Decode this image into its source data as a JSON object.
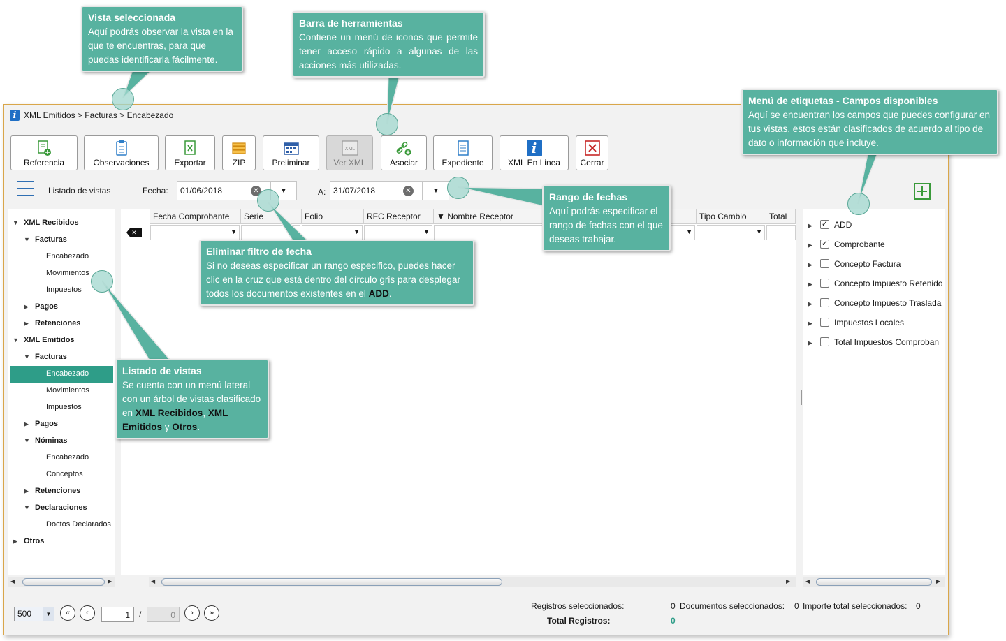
{
  "breadcrumb": "XML Emitidos > Facturas > Encabezado",
  "toolbar": {
    "referencia": "Referencia",
    "observaciones": "Observaciones",
    "exportar": "Exportar",
    "zip": "ZIP",
    "preliminar": "Preliminar",
    "ver_xml": "Ver XML",
    "asociar": "Asociar",
    "expediente": "Expediente",
    "xml_en_linea": "XML En Linea",
    "cerrar": "Cerrar",
    "xml_badge": "XML"
  },
  "filters": {
    "listado": "Listado de vistas",
    "fecha_label": "Fecha:",
    "fecha_desde": "01/06/2018",
    "a_label": "A:",
    "fecha_hasta": "31/07/2018"
  },
  "tree": {
    "xml_recibidos": "XML Recibidos",
    "facturas": "Facturas",
    "encabezado": "Encabezado",
    "movimientos": "Movimientos",
    "impuestos": "Impuestos",
    "pagos": "Pagos",
    "retenciones": "Retenciones",
    "xml_emitidos": "XML Emitidos",
    "nominas": "Nóminas",
    "conceptos": "Conceptos",
    "declaraciones": "Declaraciones",
    "doctos_declarados": "Doctos Declarados",
    "otros": "Otros"
  },
  "grid": {
    "columns": [
      "Fecha Comprobante",
      "Serie",
      "Folio",
      "RFC Receptor",
      "▼ Nombre Receptor",
      "Tipo Cambio",
      "Total"
    ]
  },
  "tags": {
    "items": [
      {
        "label": "ADD",
        "checked": true
      },
      {
        "label": "Comprobante",
        "checked": true
      },
      {
        "label": "Concepto Factura",
        "checked": false
      },
      {
        "label": "Concepto Impuesto Retenido",
        "checked": false
      },
      {
        "label": "Concepto Impuesto Traslada",
        "checked": false
      },
      {
        "label": "Impuestos Locales",
        "checked": false
      },
      {
        "label": "Total Impuestos Comproban",
        "checked": false
      }
    ],
    "check_mark": "✓"
  },
  "bottom": {
    "page_size": "500",
    "page": "1",
    "slash": "/",
    "total_pages": "0",
    "registros_sel_label": "Registros seleccionados:",
    "registros_sel_value": "0",
    "documentos_sel_label": "Documentos seleccionados:",
    "documentos_sel_value": "0",
    "importe_label": "Importe total seleccionados:",
    "importe_value": "0",
    "total_registros_label": "Total Registros:",
    "total_registros_value": "0"
  },
  "callouts": {
    "vista": {
      "title": "Vista seleccionada",
      "text": "Aquí podrás observar la vista en la que te encuentras, para que puedas identificarla fácilmente."
    },
    "barra": {
      "title": "Barra de herramientas",
      "text": "Contiene un menú de iconos que permite tener acceso rápido a algunas de las acciones más utilizadas."
    },
    "etiquetas": {
      "title": "Menú de etiquetas - Campos disponibles",
      "text": "Aquí se encuentran los campos que puedes configurar en tus vistas, estos están clasificados de acuerdo al tipo de dato o información que incluye."
    },
    "rango": {
      "title": "Rango de fechas",
      "text": "Aquí podrás especificar el rango de fechas con el que deseas trabajar."
    },
    "eliminar": {
      "title": "Eliminar filtro de fecha",
      "text_before": "Si no deseas especificar un rango especifico, puedes hacer clic en la cruz que está dentro del círculo gris para desplegar todos los documentos existentes en el ",
      "text_bold": "ADD",
      "text_after": "."
    },
    "listado": {
      "title": "Listado de vistas",
      "text_1": "Se cuenta con un menú lateral con un árbol de vistas clasificado en ",
      "bold_1": "XML Recibidos",
      "text_2": ", ",
      "bold_2": "XML Emitidos",
      "text_3": " y ",
      "bold_3": "Otros",
      "text_4": "."
    }
  },
  "colors": {
    "accent": "#2e9d88",
    "callout": "#58b2a0",
    "window_border": "#d9a64a"
  },
  "icons": [
    "info-logo-icon",
    "add-document-icon",
    "clipboard-icon",
    "excel-export-icon",
    "zip-icon",
    "calendar-preview-icon",
    "xml-file-icon",
    "link-add-icon",
    "document-list-icon",
    "close-box-icon",
    "hamburger-menu-icon",
    "add-square-icon",
    "first-page-icon",
    "prev-page-icon",
    "next-page-icon",
    "last-page-icon"
  ]
}
